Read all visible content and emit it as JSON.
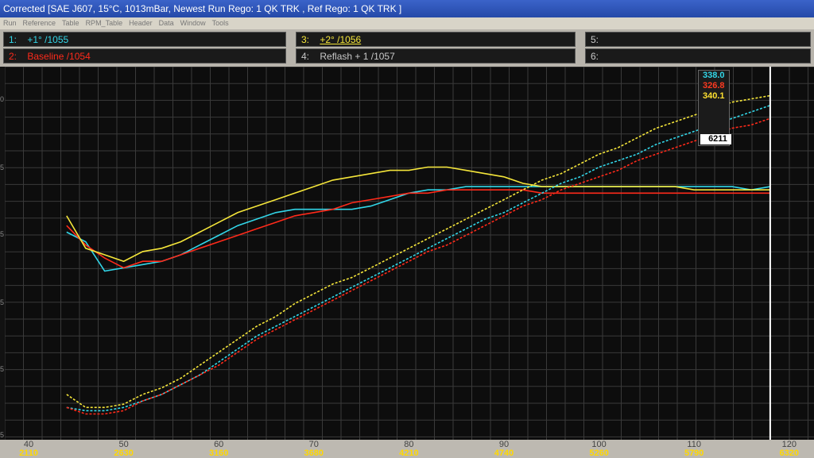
{
  "window": {
    "title": "Corrected [SAE J607, 15°C, 1013mBar,  Newest Run Rego: 1 QK TRK ,  Ref Rego: 1 QK TRK ]"
  },
  "menu": [
    "Run",
    "Reference",
    "Table",
    "RPM_Table",
    "Header",
    "Data",
    "Window",
    "Tools"
  ],
  "legend": [
    {
      "num": "1:",
      "label": "+1° /1055",
      "color": "#32d6e8"
    },
    {
      "num": "2:",
      "label": "Baseline /1054",
      "color": "#ff2a1a"
    },
    {
      "num": "3:",
      "label": "+2° /1056",
      "color": "#f5e63a"
    },
    {
      "num": "4:",
      "label": "Reflash + 1 /1057",
      "color": "#c8c8c8"
    },
    {
      "num": "5:",
      "label": "",
      "color": "#c8c8c8"
    },
    {
      "num": "6:",
      "label": "",
      "color": "#c8c8c8"
    }
  ],
  "readout": {
    "values": [
      {
        "value": "338.0",
        "color": "#32d6e8"
      },
      {
        "value": "326.8",
        "color": "#ff3a20"
      },
      {
        "value": "340.1",
        "color": "#ffe030"
      }
    ],
    "rpm": "6211"
  },
  "x_axis": {
    "ticks": [
      "40",
      "50",
      "60",
      "70",
      "80",
      "90",
      "100",
      "110",
      "120"
    ],
    "rpm_labels": [
      "2110",
      "2630",
      "3160",
      "3680",
      "4210",
      "4740",
      "5260",
      "5790",
      "6320"
    ]
  },
  "y_ticks": [
    "0",
    "5",
    "5",
    "5",
    "5",
    "5"
  ],
  "colors": {
    "cyan": "#32d6e8",
    "red": "#ff2a1a",
    "yellow": "#f5e63a",
    "grid": "#3a3a3a"
  },
  "chart_data": {
    "type": "line",
    "xlim": [
      40,
      120
    ],
    "cursor_x": 118,
    "series": [
      {
        "name": "+1° /1055",
        "style": "solid",
        "x": [
          44,
          46,
          48,
          50,
          52,
          54,
          56,
          58,
          60,
          62,
          64,
          66,
          68,
          70,
          72,
          74,
          76,
          78,
          80,
          82,
          84,
          86,
          88,
          90,
          92,
          94,
          96,
          98,
          100,
          102,
          104,
          106,
          108,
          110,
          112,
          114,
          116,
          118
        ],
        "y": [
          62,
          59,
          50,
          51,
          52,
          53,
          55,
          58,
          61,
          64,
          66,
          68,
          69,
          69,
          69,
          69,
          70,
          72,
          74,
          75,
          75,
          76,
          76,
          76,
          76,
          76,
          76,
          76,
          76,
          76,
          76,
          76,
          76,
          76,
          76,
          76,
          75,
          76
        ]
      },
      {
        "name": "Baseline /1054",
        "style": "solid",
        "x": [
          44,
          46,
          48,
          50,
          52,
          54,
          56,
          58,
          60,
          62,
          64,
          66,
          68,
          70,
          72,
          74,
          76,
          78,
          80,
          82,
          84,
          86,
          88,
          90,
          92,
          94,
          96,
          98,
          100,
          102,
          104,
          106,
          108,
          110,
          112,
          114,
          116,
          118
        ],
        "y": [
          64,
          58,
          54,
          51,
          53,
          53,
          55,
          57,
          59,
          61,
          63,
          65,
          67,
          68,
          69,
          71,
          72,
          73,
          74,
          74,
          75,
          75,
          75,
          75,
          75,
          74,
          74,
          74,
          74,
          74,
          74,
          74,
          74,
          74,
          74,
          74,
          74,
          74
        ]
      },
      {
        "name": "+2° /1056",
        "style": "solid",
        "x": [
          44,
          46,
          48,
          50,
          52,
          54,
          56,
          58,
          60,
          62,
          64,
          66,
          68,
          70,
          72,
          74,
          76,
          78,
          80,
          82,
          84,
          86,
          88,
          90,
          92,
          94,
          96,
          98,
          100,
          102,
          104,
          106,
          108,
          110,
          112,
          114,
          116,
          118
        ],
        "y": [
          67,
          57,
          55,
          53,
          56,
          57,
          59,
          62,
          65,
          68,
          70,
          72,
          74,
          76,
          78,
          79,
          80,
          81,
          81,
          82,
          82,
          81,
          80,
          79,
          77,
          76,
          76,
          76,
          76,
          76,
          76,
          76,
          76,
          75,
          75,
          75,
          75,
          75
        ]
      },
      {
        "name": "+1° /1055 (2)",
        "style": "dashed",
        "x": [
          44,
          46,
          48,
          50,
          52,
          54,
          56,
          58,
          60,
          62,
          64,
          66,
          68,
          70,
          72,
          74,
          76,
          78,
          80,
          82,
          84,
          86,
          88,
          90,
          92,
          94,
          96,
          98,
          100,
          102,
          104,
          106,
          108,
          110,
          112,
          114,
          116,
          118
        ],
        "y": [
          8,
          7,
          7,
          8,
          10,
          12,
          15,
          18,
          22,
          26,
          30,
          33,
          36,
          39,
          42,
          45,
          48,
          51,
          54,
          57,
          60,
          63,
          66,
          68,
          71,
          74,
          77,
          79,
          82,
          84,
          86,
          89,
          91,
          93,
          95,
          97,
          99,
          101
        ]
      },
      {
        "name": "Baseline /1054 (2)",
        "style": "dashed",
        "x": [
          44,
          46,
          48,
          50,
          52,
          54,
          56,
          58,
          60,
          62,
          64,
          66,
          68,
          70,
          72,
          74,
          76,
          78,
          80,
          82,
          84,
          86,
          88,
          90,
          92,
          94,
          96,
          98,
          100,
          102,
          104,
          106,
          108,
          110,
          112,
          114,
          116,
          118
        ],
        "y": [
          8,
          6,
          6,
          7,
          10,
          12,
          15,
          18,
          21,
          25,
          29,
          32,
          35,
          38,
          41,
          44,
          47,
          50,
          53,
          56,
          58,
          61,
          64,
          67,
          70,
          72,
          75,
          77,
          79,
          81,
          84,
          86,
          88,
          90,
          92,
          94,
          95,
          97
        ]
      },
      {
        "name": "+2° /1056 (2)",
        "style": "dashed",
        "x": [
          44,
          46,
          48,
          50,
          52,
          54,
          56,
          58,
          60,
          62,
          64,
          66,
          68,
          70,
          72,
          74,
          76,
          78,
          80,
          82,
          84,
          86,
          88,
          90,
          92,
          94,
          96,
          98,
          100,
          102,
          104,
          106,
          108,
          110,
          112,
          114,
          116,
          118
        ],
        "y": [
          12,
          8,
          8,
          9,
          12,
          14,
          17,
          21,
          25,
          29,
          33,
          36,
          40,
          43,
          46,
          48,
          51,
          54,
          57,
          60,
          63,
          66,
          69,
          72,
          75,
          78,
          80,
          83,
          86,
          88,
          91,
          94,
          96,
          98,
          100,
          102,
          103,
          104
        ]
      }
    ],
    "ylim": [
      0,
      110
    ]
  }
}
